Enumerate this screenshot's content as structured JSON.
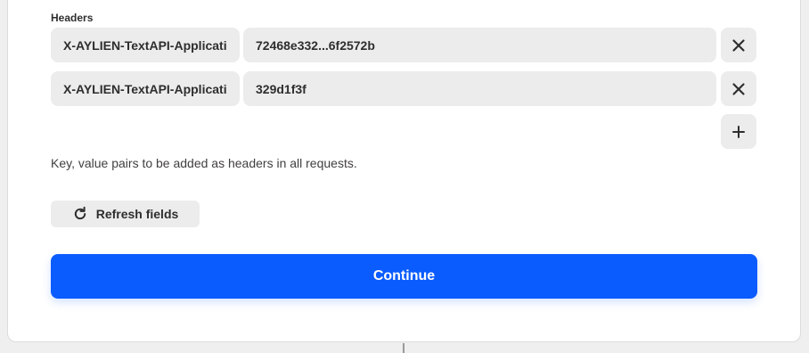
{
  "headers": {
    "label": "Headers",
    "rows": [
      {
        "key": "X-AYLIEN-TextAPI-Application-Id",
        "value": "72468e332...6f2572b"
      },
      {
        "key": "X-AYLIEN-TextAPI-Application-Key",
        "value": "329d1f3f"
      }
    ],
    "remove_icon": "close-icon",
    "add_icon": "plus-icon",
    "help_text": "Key, value pairs to be added as headers in all requests."
  },
  "actions": {
    "refresh_label": "Refresh fields",
    "refresh_icon": "refresh-icon",
    "continue_label": "Continue"
  },
  "colors": {
    "primary": "#0b5cff",
    "field_bg": "#ececec",
    "text": "#2d2e2e"
  }
}
